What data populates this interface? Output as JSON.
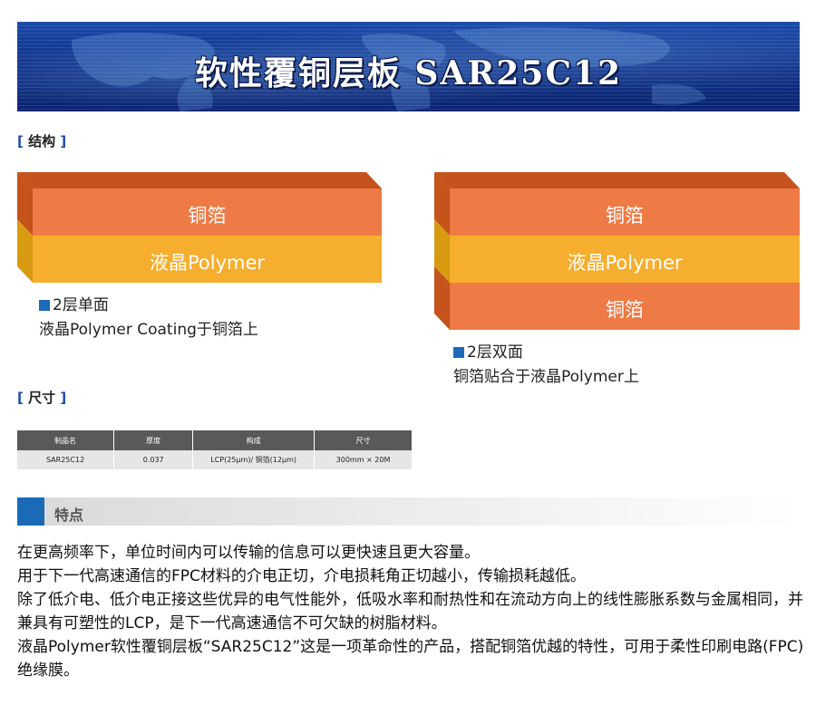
{
  "banner": {
    "title": "软性覆铜层板 SAR25C12"
  },
  "sections": {
    "structure": "结构",
    "size": "尺寸"
  },
  "structure": {
    "single": {
      "layers": [
        "铜箔",
        "液晶Polymer"
      ],
      "title": "2层单面",
      "desc": "液晶Polymer Coating于铜箔上"
    },
    "double": {
      "layers": [
        "铜箔",
        "液晶Polymer",
        "铜箔"
      ],
      "title": "2层双面",
      "desc": "铜箔贴合于液晶Polymer上"
    }
  },
  "spec_table": {
    "headers": [
      "制品名",
      "厚度",
      "构成",
      "尺寸"
    ],
    "rows": [
      [
        "SAR25C12",
        "0.037",
        "LCP(25μm)/ 铜箔(12μm)",
        "300mm × 20M"
      ]
    ]
  },
  "features": {
    "heading": "特点",
    "lines": [
      "在更高频率下，单位时间内可以传输的信息可以更快速且更大容量。",
      "用于下一代高速通信的FPC材料的介电正切，介电损耗角正切越小，传输损耗越低。",
      "除了低介电、低介电正接这些优异的电气性能外，低吸水率和耐热性和在流动方向上的线性膨胀系数与金属相同，并兼具有可塑性的LCP，是下一代高速通信不可欠缺的树脂材料。",
      "液晶Polymer软性覆铜层板“SAR25C12”这是一项革命性的产品，搭配铜箔优越的特性，可用于柔性印刷电路(FPC)绝缘膜。"
    ]
  },
  "colors": {
    "copper": "#ee7a45",
    "lcp": "#f5ae2d",
    "accent": "#1a6ab8",
    "banner": "#0e2f86"
  }
}
